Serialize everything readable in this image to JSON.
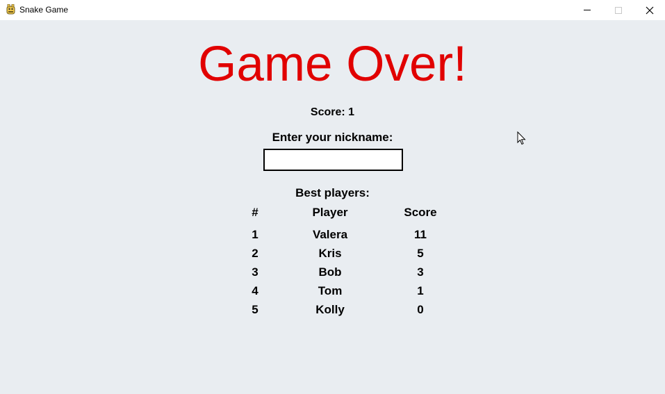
{
  "window": {
    "title": "Snake Game",
    "icon": "pygame-snake-icon"
  },
  "game_over": {
    "headline": "Game Over!",
    "score_text": "Score: 1",
    "nickname_prompt": "Enter your nickname:",
    "nickname_value": "",
    "best_players_label": "Best players:"
  },
  "leaderboard": {
    "headers": {
      "rank": "#",
      "player": "Player",
      "score": "Score"
    },
    "rows": [
      {
        "rank": "1",
        "player": "Valera",
        "score": "11"
      },
      {
        "rank": "2",
        "player": "Kris",
        "score": "5"
      },
      {
        "rank": "3",
        "player": "Bob",
        "score": "3"
      },
      {
        "rank": "4",
        "player": "Tom",
        "score": "1"
      },
      {
        "rank": "5",
        "player": "Kolly",
        "score": "0"
      }
    ]
  },
  "colors": {
    "background": "#e9edf1",
    "headline": "#e10000",
    "text": "#000000"
  }
}
